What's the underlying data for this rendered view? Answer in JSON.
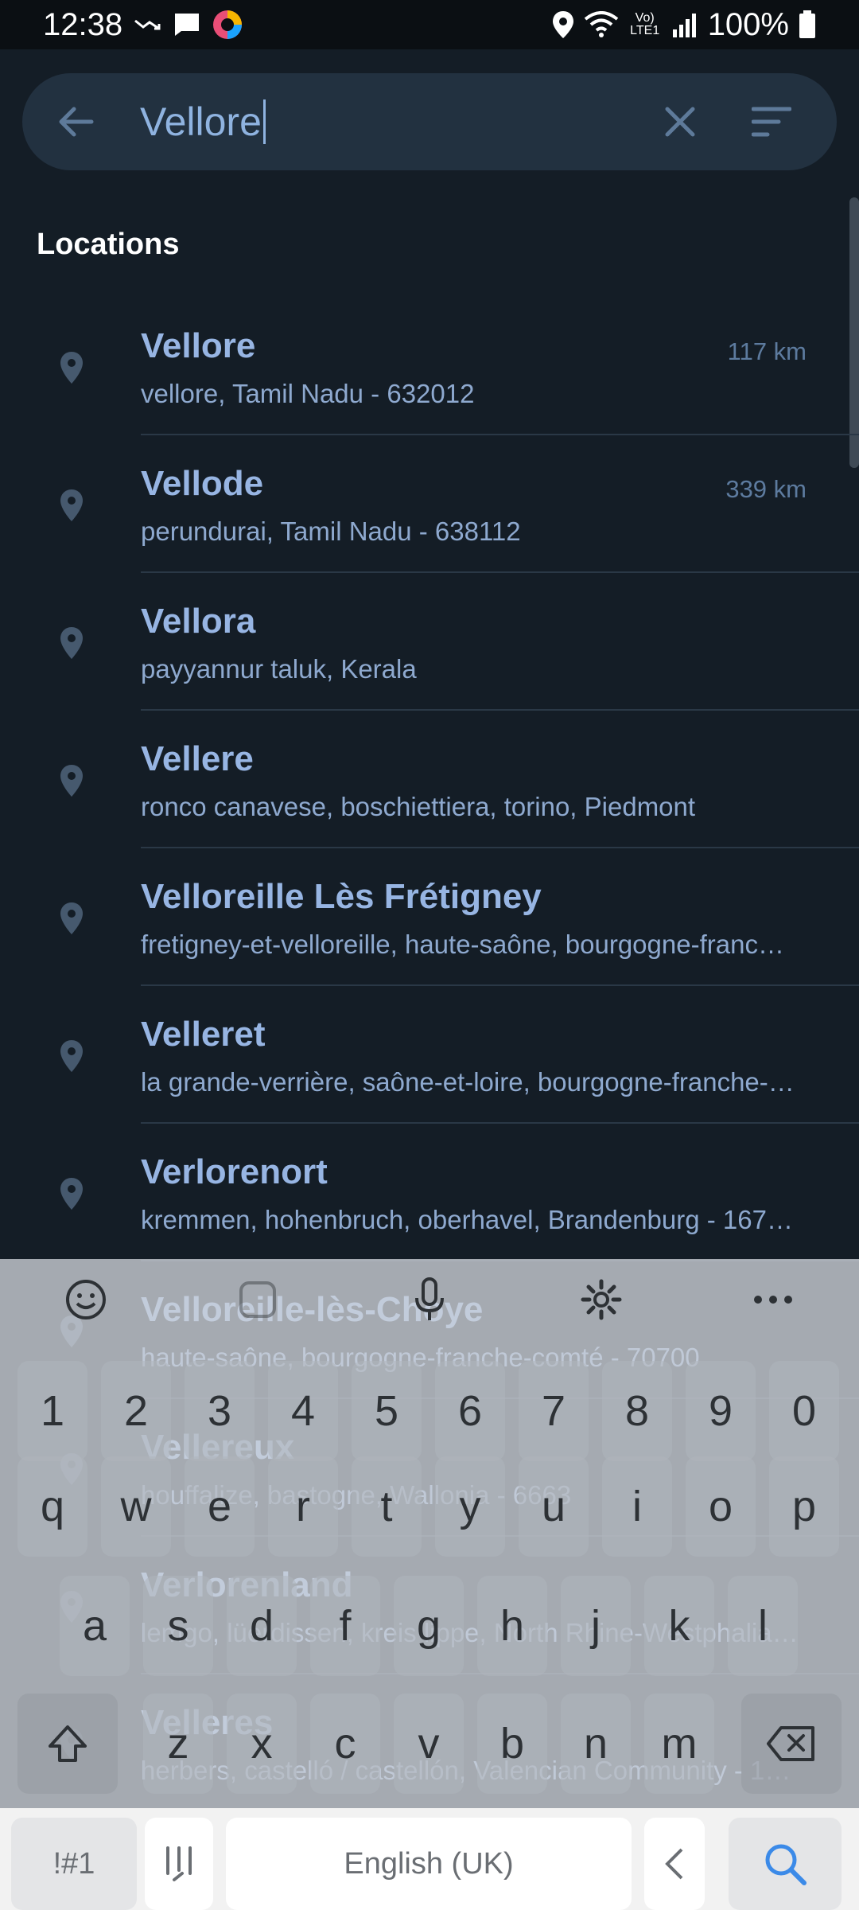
{
  "status_bar": {
    "time": "12:38",
    "battery": "100%",
    "network_label": "Vo) LTE1"
  },
  "search": {
    "query": "Vellore"
  },
  "section": {
    "title": "Locations"
  },
  "results": [
    {
      "name": "Vellore",
      "subtitle": "vellore, Tamil Nadu - 632012",
      "distance": "117 km"
    },
    {
      "name": "Vellode",
      "subtitle": "perundurai, Tamil Nadu - 638112",
      "distance": "339 km"
    },
    {
      "name": "Vellora",
      "subtitle": "payyannur taluk, Kerala",
      "distance": ""
    },
    {
      "name": "Vellere",
      "subtitle": "ronco canavese, boschiettiera, torino, Piedmont",
      "distance": ""
    },
    {
      "name": "Velloreille Lès Frétigney",
      "subtitle": "fretigney-et-velloreille, haute-saône, bourgogne-franc…",
      "distance": ""
    },
    {
      "name": "Velleret",
      "subtitle": "la grande-verrière, saône-et-loire, bourgogne-franche-…",
      "distance": ""
    },
    {
      "name": "Verlorenort",
      "subtitle": "kremmen, hohenbruch, oberhavel, Brandenburg - 167…",
      "distance": ""
    },
    {
      "name": "Velloreille-lès-Choye",
      "subtitle": "haute-saône, bourgogne-franche-comté - 70700",
      "distance": ""
    },
    {
      "name": "Vellereux",
      "subtitle": "houffalize, bastogne, Wallonia - 6663",
      "distance": ""
    },
    {
      "name": "Verlorenland",
      "subtitle": "lemgo, lüerdissen, kreis lippe, North Rhine-Westphalia…",
      "distance": ""
    },
    {
      "name": "Velleres",
      "subtitle": "herbers, castelló / castellón, Valencian Community - 1…",
      "distance": ""
    }
  ],
  "keyboard": {
    "number_row": [
      "1",
      "2",
      "3",
      "4",
      "5",
      "6",
      "7",
      "8",
      "9",
      "0"
    ],
    "row1": [
      "q",
      "w",
      "e",
      "r",
      "t",
      "y",
      "u",
      "i",
      "o",
      "p"
    ],
    "row2": [
      "a",
      "s",
      "d",
      "f",
      "g",
      "h",
      "j",
      "k",
      "l"
    ],
    "row3": [
      "z",
      "x",
      "c",
      "v",
      "b",
      "n",
      "m"
    ],
    "symbols_label": "!#1",
    "space_label": "English (UK)"
  },
  "colors": {
    "background": "#141d26",
    "search_bg": "#223140",
    "accent": "#97b5e3"
  }
}
